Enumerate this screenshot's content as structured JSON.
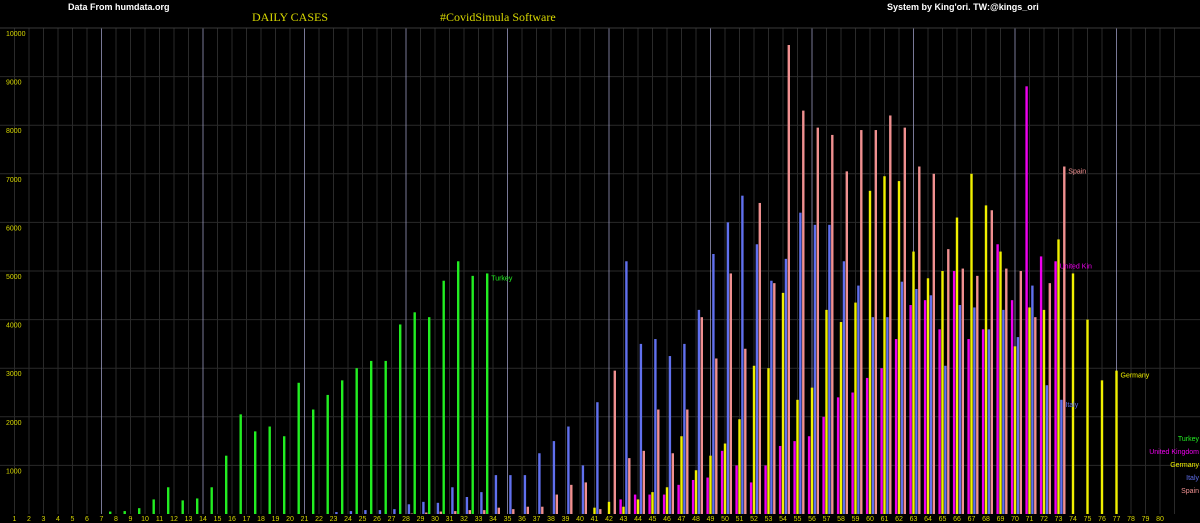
{
  "header": {
    "source": "Data From humdata.org",
    "title": "DAILY CASES",
    "software": "#CovidSimula Software",
    "credit": "System by King'ori. TW:@kings_ori"
  },
  "colors": {
    "background": "#000000",
    "grid_major": "#a0a0c8",
    "grid_minor": "#2a2a2a",
    "tick_text": "#d8d800"
  },
  "chart_data": {
    "type": "bar",
    "title": "DAILY CASES",
    "xlim": [
      0,
      80
    ],
    "ylim": [
      0,
      10000
    ],
    "x_ticks": [
      1,
      2,
      3,
      4,
      5,
      6,
      7,
      8,
      9,
      10,
      11,
      12,
      13,
      14,
      15,
      16,
      17,
      18,
      19,
      20,
      21,
      22,
      23,
      24,
      25,
      26,
      27,
      28,
      29,
      30,
      31,
      32,
      33,
      34,
      35,
      36,
      37,
      38,
      39,
      40,
      41,
      42,
      43,
      44,
      45,
      46,
      47,
      48,
      49,
      50,
      51,
      52,
      53,
      54,
      55,
      56,
      57,
      58,
      59,
      60,
      61,
      62,
      63,
      64,
      65,
      66,
      67,
      68,
      69,
      70,
      71,
      72,
      73,
      74,
      75,
      76,
      77,
      78,
      79,
      80
    ],
    "y_ticks": [
      1000,
      2000,
      3000,
      4000,
      5000,
      6000,
      7000,
      8000,
      9000,
      10000
    ],
    "grid": true,
    "legend_position": "bottom-right",
    "series": [
      {
        "name": "Turkey",
        "color": "#22ee22",
        "end_label": "Turkey",
        "x": [
          8,
          9,
          10,
          11,
          12,
          13,
          14,
          15,
          16,
          17,
          18,
          19,
          20,
          21,
          22,
          23,
          24,
          25,
          26,
          27,
          28,
          29,
          30,
          31,
          32,
          33,
          34
        ],
        "values": [
          50,
          60,
          120,
          300,
          550,
          280,
          320,
          550,
          1200,
          2050,
          1700,
          1800,
          1600,
          2700,
          2150,
          2450,
          2750,
          3000,
          3150,
          3150,
          3900,
          4150,
          4050,
          4800,
          5200,
          4900,
          4950
        ]
      },
      {
        "name": "United Kingdom",
        "color": "#ee00ee",
        "end_label": "United Kin",
        "x": [
          43,
          44,
          45,
          46,
          47,
          48,
          49,
          50,
          51,
          52,
          53,
          54,
          55,
          56,
          57,
          58,
          59,
          60,
          61,
          62,
          63,
          64,
          65,
          66,
          67,
          68,
          69,
          70,
          71,
          72,
          73
        ],
        "values": [
          300,
          400,
          400,
          400,
          600,
          700,
          750,
          1300,
          1000,
          650,
          1000,
          1400,
          1500,
          1600,
          2000,
          2400,
          2500,
          2800,
          3000,
          3600,
          4300,
          4400,
          3800,
          5000,
          3600,
          3800,
          5550,
          4400,
          8800,
          5300,
          5200
        ]
      },
      {
        "name": "Germany",
        "color": "#f0f000",
        "end_label": "Germany",
        "x": [
          41,
          42,
          43,
          44,
          45,
          46,
          47,
          48,
          49,
          50,
          51,
          52,
          53,
          54,
          55,
          56,
          57,
          58,
          59,
          60,
          61,
          62,
          63,
          64,
          65,
          66,
          67,
          68,
          69,
          70,
          71,
          72,
          73,
          74,
          75,
          76,
          77
        ],
        "values": [
          130,
          250,
          150,
          300,
          450,
          550,
          1600,
          900,
          1200,
          1450,
          1950,
          3050,
          3000,
          4550,
          2350,
          2600,
          4200,
          3950,
          4350,
          6650,
          6950,
          6850,
          5400,
          4850,
          5000,
          6100,
          7000,
          6350,
          5400,
          3450,
          4250,
          4200,
          5650,
          4950,
          4000,
          2750,
          2950
        ]
      },
      {
        "name": "Italy",
        "color": "#6070ee",
        "end_label": "Italy",
        "x": [
          1,
          2,
          3,
          4,
          5,
          6,
          7,
          8,
          9,
          10,
          11,
          12,
          13,
          14,
          15,
          16,
          17,
          18,
          19,
          20,
          21,
          22,
          23,
          24,
          25,
          26,
          27,
          28,
          29,
          30,
          31,
          32,
          33,
          34,
          35,
          36,
          37,
          38,
          39,
          40,
          41,
          42,
          43,
          44,
          45,
          46,
          47,
          48,
          49,
          50,
          51,
          52,
          53,
          54,
          55,
          56,
          57,
          58,
          59,
          60,
          61,
          62,
          63,
          64,
          65,
          66,
          67,
          68,
          69,
          70,
          71,
          72,
          73
        ],
        "values": [
          0,
          0,
          0,
          0,
          0,
          0,
          0,
          0,
          0,
          0,
          0,
          0,
          0,
          0,
          0,
          0,
          0,
          0,
          0,
          0,
          0,
          0,
          40,
          60,
          80,
          80,
          100,
          200,
          250,
          230,
          550,
          350,
          450,
          800,
          800,
          800,
          1250,
          1500,
          1800,
          1000,
          2300,
          0,
          5200,
          3500,
          3600,
          3250,
          3500,
          4200,
          5350,
          6000,
          6550,
          5550,
          4800,
          5250,
          6200,
          5950,
          5950,
          5200,
          4700,
          4050,
          4050,
          4780,
          4630,
          4500,
          3050,
          4300,
          4250,
          3800,
          4200,
          3640,
          4700,
          2650,
          2350
        ]
      },
      {
        "name": "Spain",
        "color": "#f09090",
        "end_label": "Spain",
        "x": [
          28,
          29,
          30,
          31,
          32,
          33,
          34,
          35,
          36,
          37,
          38,
          39,
          40,
          41,
          42,
          43,
          44,
          45,
          46,
          47,
          48,
          49,
          50,
          51,
          52,
          53,
          54,
          55,
          56,
          57,
          58,
          59,
          60,
          61,
          62,
          63,
          64,
          65,
          66,
          67,
          68,
          69,
          70,
          71,
          72,
          73
        ],
        "values": [
          10,
          30,
          50,
          60,
          80,
          80,
          130,
          100,
          150,
          150,
          400,
          600,
          650,
          100,
          2950,
          1150,
          1300,
          2150,
          1250,
          2150,
          4050,
          3200,
          4950,
          3400,
          6400,
          4750,
          9650,
          8300,
          7950,
          7800,
          7050,
          7900,
          7900,
          8200,
          7950,
          7150,
          7000,
          5450,
          5050,
          4900,
          6250,
          5050,
          5000,
          4050,
          4750,
          7150
        ]
      }
    ]
  }
}
